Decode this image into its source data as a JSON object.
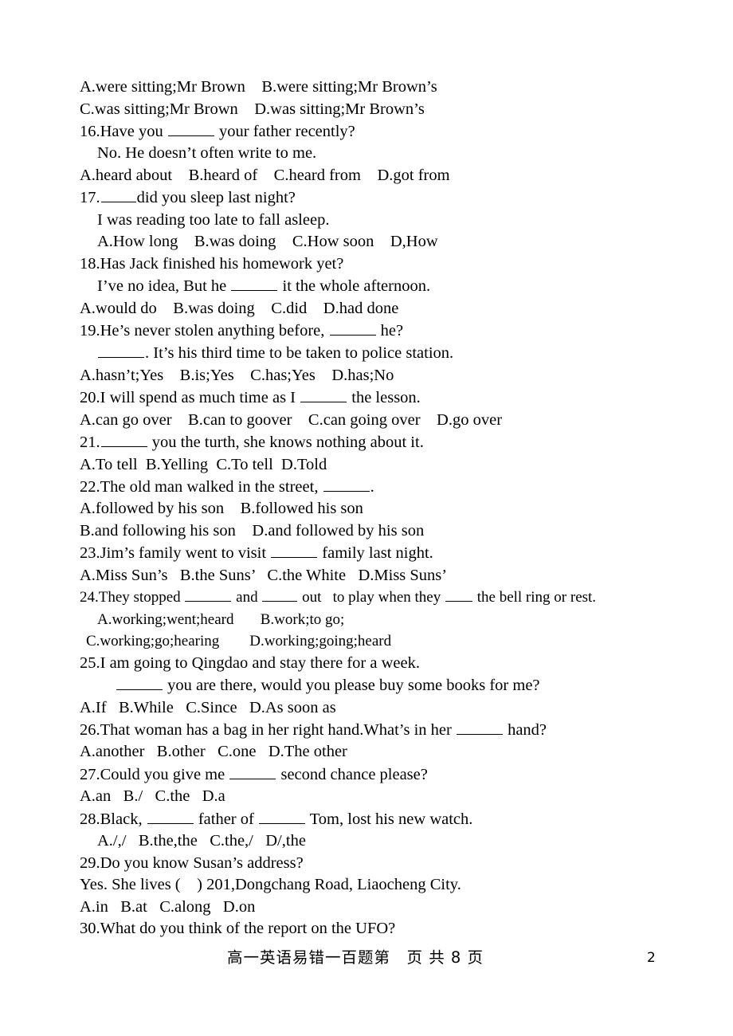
{
  "document": {
    "footer": {
      "center_text": "高一英语易错一百题第　页 共 8 页",
      "page_number": "2"
    }
  },
  "lines": [
    {
      "id": "l01",
      "text": "A.were sitting;Mr Brown    B.were sitting;Mr Brown’s",
      "indent": "ind-0"
    },
    {
      "id": "l02",
      "text": "C.was sitting;Mr Brown    D.was sitting;Mr Brown’s",
      "indent": "ind-0"
    },
    {
      "id": "l03",
      "indent": "ind-0",
      "parts": [
        {
          "t": "16.Have you "
        },
        {
          "blank": "b-md"
        },
        {
          "t": " your father recently?"
        }
      ]
    },
    {
      "id": "l04",
      "text": "No. He doesn’t often write to me.",
      "indent": "ind-1"
    },
    {
      "id": "l05",
      "text": "A.heard about    B.heard of    C.heard from    D.got from",
      "indent": "ind-0"
    },
    {
      "id": "l06",
      "indent": "ind-0",
      "parts": [
        {
          "t": "17."
        },
        {
          "blank": "b-sm"
        },
        {
          "t": "did you sleep last night?"
        }
      ]
    },
    {
      "id": "l07",
      "text": "I was reading too late to fall asleep.",
      "indent": "ind-1"
    },
    {
      "id": "l08",
      "text": "A.How long    B.was doing    C.How soon    D,How",
      "indent": "ind-1"
    },
    {
      "id": "l09",
      "text": "18.Has Jack finished his homework yet?",
      "indent": "ind-0"
    },
    {
      "id": "l10",
      "indent": "ind-1",
      "parts": [
        {
          "t": "I’ve no idea, But he "
        },
        {
          "blank": "b-md"
        },
        {
          "t": " it the whole afternoon."
        }
      ]
    },
    {
      "id": "l11",
      "text": "A.would do    B.was doing    C.did    D.had done",
      "indent": "ind-0"
    },
    {
      "id": "l12",
      "indent": "ind-0",
      "parts": [
        {
          "t": "19.He’s never stolen anything before, "
        },
        {
          "blank": "b-md"
        },
        {
          "t": " he?"
        }
      ]
    },
    {
      "id": "l13",
      "indent": "ind-1",
      "parts": [
        {
          "blank": "b-md"
        },
        {
          "t": ". It’s his third time to be taken to police station."
        }
      ]
    },
    {
      "id": "l14",
      "text": "A.hasn’t;Yes    B.is;Yes    C.has;Yes    D.has;No",
      "indent": "ind-0"
    },
    {
      "id": "l15",
      "indent": "ind-0",
      "parts": [
        {
          "t": "20.I will spend as much time as I "
        },
        {
          "blank": "b-md"
        },
        {
          "t": " the lesson."
        }
      ]
    },
    {
      "id": "l16",
      "text": "A.can go over    B.can to goover    C.can going over    D.go over",
      "indent": "ind-0"
    },
    {
      "id": "l17",
      "indent": "ind-0",
      "parts": [
        {
          "t": "21."
        },
        {
          "blank": "b-md"
        },
        {
          "t": " you the turth, she knows nothing about it."
        }
      ]
    },
    {
      "id": "l18",
      "text": "A.To tell  B.Yelling  C.To tell  D.Told",
      "indent": "ind-0"
    },
    {
      "id": "l19",
      "indent": "ind-0",
      "parts": [
        {
          "t": "22.The old man walked in the street, "
        },
        {
          "blank": "b-md"
        },
        {
          "t": "."
        }
      ]
    },
    {
      "id": "l20",
      "text": "A.followed by his son    B.followed his son",
      "indent": "ind-0"
    },
    {
      "id": "l21",
      "text": "B.and following his son    D.and followed by his son",
      "indent": "ind-0"
    },
    {
      "id": "l22",
      "indent": "ind-0",
      "parts": [
        {
          "t": "23.Jim’s family went to visit "
        },
        {
          "blank": "b-md"
        },
        {
          "t": " family last night."
        }
      ]
    },
    {
      "id": "l23",
      "text": "A.Miss Sun’s   B.the Suns’   C.the White   D.Miss Suns’",
      "indent": "ind-0"
    },
    {
      "id": "l24",
      "indent": "ind-0",
      "small": true,
      "parts": [
        {
          "t": "24.They stopped "
        },
        {
          "blank": "b-md"
        },
        {
          "t": " and "
        },
        {
          "blank": "b-sm"
        },
        {
          "t": " out   to play when they "
        },
        {
          "blank": "b-xs"
        },
        {
          "t": " the bell ring or rest."
        }
      ]
    },
    {
      "id": "l25",
      "text": "A.working;went;heard       B.work;to go;",
      "indent": "ind-1",
      "small": true
    },
    {
      "id": "l26",
      "text": "C.working;go;hearing        D.working;going;heard",
      "indent": "ind-4",
      "small": true
    },
    {
      "id": "l27",
      "text": "25.I am going to Qingdao and stay there for a week.",
      "indent": "ind-0"
    },
    {
      "id": "l28",
      "indent": "ind-3",
      "parts": [
        {
          "blank": "b-md"
        },
        {
          "t": " you are there, would you please buy some books for me?"
        }
      ]
    },
    {
      "id": "l29",
      "text": "A.If   B.While   C.Since   D.As soon as",
      "indent": "ind-0"
    },
    {
      "id": "l30",
      "indent": "ind-0",
      "parts": [
        {
          "t": "26.That woman has a bag in her right hand.What’s in her "
        },
        {
          "blank": "b-md"
        },
        {
          "t": " hand?"
        }
      ]
    },
    {
      "id": "l31",
      "text": "A.another   B.other   C.one   D.The other",
      "indent": "ind-0"
    },
    {
      "id": "l32",
      "indent": "ind-0",
      "parts": [
        {
          "t": "27.Could you give me "
        },
        {
          "blank": "b-md"
        },
        {
          "t": " second chance please?"
        }
      ]
    },
    {
      "id": "l33",
      "text": "A.an   B./   C.the   D.a",
      "indent": "ind-0"
    },
    {
      "id": "l34",
      "indent": "ind-0",
      "parts": [
        {
          "t": "28.Black, "
        },
        {
          "blank": "b-md"
        },
        {
          "t": " father of "
        },
        {
          "blank": "b-md"
        },
        {
          "t": " Tom, lost his new watch."
        }
      ]
    },
    {
      "id": "l35",
      "text": "A./,/   B.the,the   C.the,/   D/,the",
      "indent": "ind-1"
    },
    {
      "id": "l36",
      "text": "29.Do you know Susan’s address?",
      "indent": "ind-0"
    },
    {
      "id": "l37",
      "text": "Yes. She lives (    ) 201,Dongchang Road, Liaocheng City.",
      "indent": "ind-0"
    },
    {
      "id": "l38",
      "text": "A.in   B.at   C.along   D.on",
      "indent": "ind-0"
    },
    {
      "id": "l39",
      "text": "30.What do you think of the report on the UFO?",
      "indent": "ind-0"
    }
  ]
}
